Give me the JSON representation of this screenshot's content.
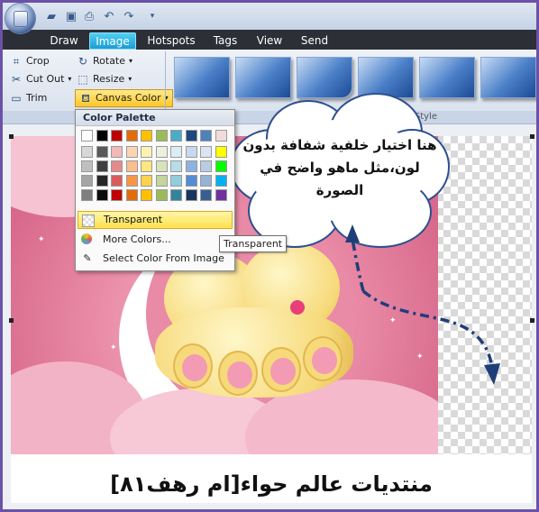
{
  "tabs": [
    "Draw",
    "Image",
    "Hotspots",
    "Tags",
    "View",
    "Send"
  ],
  "active_tab": "Image",
  "ribbon": {
    "crop": "Crop",
    "cut_out": "Cut Out",
    "trim": "Trim",
    "rotate": "Rotate",
    "resize": "Resize",
    "canvas_color": "Canvas Color",
    "group_label": "C",
    "style_group_label": "Style"
  },
  "palette": {
    "title": "Color Palette",
    "transparent": "Transparent",
    "more_colors": "More Colors...",
    "select_from_image": "Select Color From Image",
    "top_row": [
      "#ffffff",
      "#000000",
      "#c00000",
      "#e36c09",
      "#ffc000",
      "#9bbb59",
      "#4bacc6",
      "#1f497d",
      "#4f81bd",
      "#f2dcdb"
    ],
    "columns": [
      [
        "#d8d8d8",
        "#bfbfbf",
        "#a5a5a5",
        "#7f7f7f"
      ],
      [
        "#595959",
        "#3f3f3f",
        "#262626",
        "#0c0c0c"
      ],
      [
        "#f2b8b8",
        "#e58a8a",
        "#d85c5c",
        "#c00000"
      ],
      [
        "#fbd4b4",
        "#f9bf8f",
        "#f79646",
        "#e36c09"
      ],
      [
        "#fff2b3",
        "#ffe680",
        "#ffd24d",
        "#ffc000"
      ],
      [
        "#ebf1de",
        "#d7e4bc",
        "#c3d69b",
        "#9bbb59"
      ],
      [
        "#dbeef3",
        "#b7dde8",
        "#92cddc",
        "#31859b"
      ],
      [
        "#c6d9f0",
        "#8db3e2",
        "#548dd4",
        "#17365d"
      ],
      [
        "#dbe5f1",
        "#b8cce4",
        "#95b3d7",
        "#366092"
      ],
      [
        "#ffff00",
        "#00ff00",
        "#00b0f0",
        "#7030a0"
      ]
    ]
  },
  "tooltip": "Transparent",
  "speech_text": "هنا اختيار خلفية شفافة بدون لون،مثل ماهو واضح في الصورة",
  "caption": "منتديات عالم حواء[ام رهف٨١]"
}
